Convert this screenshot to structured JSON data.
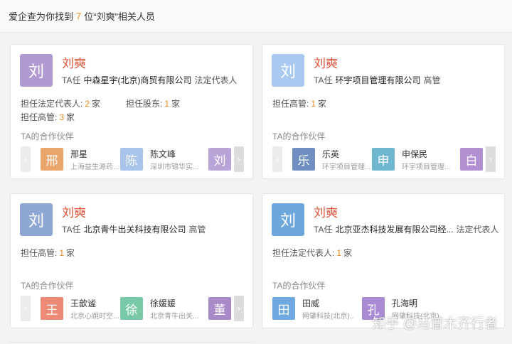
{
  "header": {
    "prefix": "爱企查为你找到",
    "count": "7",
    "suffix": "位“刘奭”相关人员"
  },
  "cards": [
    {
      "avatar_char": "刘",
      "avatar_color": "#b19ad1",
      "name": "刘奭",
      "role_prefix": "TA任",
      "company": "中森星宇(北京)商贸有限公司",
      "role": "法定代表人",
      "stats": [
        {
          "label": "担任法定代表人:",
          "value": "2",
          "unit": "家"
        },
        {
          "label": "担任股东:",
          "value": "1",
          "unit": "家"
        },
        {
          "label": "担任高管:",
          "value": "3",
          "unit": "家"
        }
      ],
      "partners_title": "TA的合作伙伴",
      "partners": [
        {
          "avatar_char": "邢",
          "avatar_color": "#eaa56b",
          "name": "邢星",
          "company": "上海益生源药..."
        },
        {
          "avatar_char": "陈",
          "avatar_color": "#a9c4ea",
          "name": "陈文峰",
          "company": "深圳市锦华实..."
        },
        {
          "avatar_char": "刘",
          "avatar_color": "#b9a4d8",
          "name": "",
          "company": ""
        }
      ]
    },
    {
      "avatar_char": "刘",
      "avatar_color": "#a9c9f0",
      "name": "刘奭",
      "role_prefix": "TA任",
      "company": "环宇项目管理有限公司",
      "role": "高管",
      "stats": [
        {
          "label": "担任高管:",
          "value": "1",
          "unit": "家"
        }
      ],
      "partners_title": "TA的合作伙伴",
      "partners": [
        {
          "avatar_char": "乐",
          "avatar_color": "#6f8fc0",
          "name": "乐英",
          "company": "环宇项目管理..."
        },
        {
          "avatar_char": "申",
          "avatar_color": "#6fb6cf",
          "name": "申保民",
          "company": "环宇项目管理..."
        },
        {
          "avatar_char": "白",
          "avatar_color": "#b28fd0",
          "name": "",
          "company": ""
        }
      ]
    },
    {
      "avatar_char": "刘",
      "avatar_color": "#8fa7d3",
      "name": "刘奭",
      "role_prefix": "TA任",
      "company": "北京青牛出关科技有限公司",
      "role": "高管",
      "stats": [
        {
          "label": "担任高管:",
          "value": "1",
          "unit": "家"
        }
      ],
      "partners_title": "TA的合作伙伴",
      "partners": [
        {
          "avatar_char": "王",
          "avatar_color": "#ec8a76",
          "name": "王歆谧",
          "company": "北京心跳时空..."
        },
        {
          "avatar_char": "徐",
          "avatar_color": "#79c9a6",
          "name": "徐媛媛",
          "company": "北京青牛出关..."
        },
        {
          "avatar_char": "董",
          "avatar_color": "#a98ac9",
          "name": "",
          "company": ""
        }
      ]
    },
    {
      "avatar_char": "刘",
      "avatar_color": "#6ea7dc",
      "name": "刘奭",
      "role_prefix": "TA任",
      "company": "北京亚杰科技发展有限公司经...",
      "role": "法定代表人",
      "stats": [
        {
          "label": "担任法定代表人:",
          "value": "1",
          "unit": "家"
        }
      ],
      "partners_title": "TA的合作伙伴",
      "partners": [
        {
          "avatar_char": "田",
          "avatar_color": "#6ea9e0",
          "name": "田威",
          "company": "网肇科技(北京)..."
        },
        {
          "avatar_char": "孔",
          "avatar_color": "#a88bd2",
          "name": "孔海明",
          "company": "网肇科技(北京)..."
        }
      ]
    }
  ],
  "watermark": "知乎 @马普木齐行者"
}
